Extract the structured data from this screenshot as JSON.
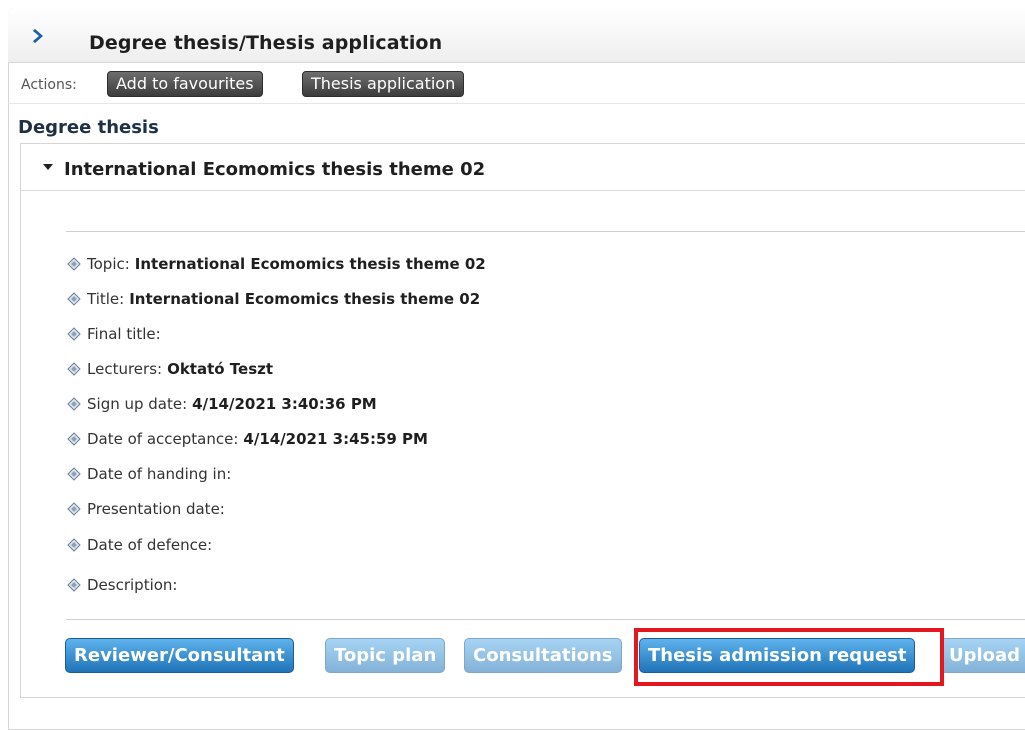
{
  "header": {
    "title": "Degree thesis/Thesis application",
    "chevron_icon": "chevron-right-icon"
  },
  "actions": {
    "label": "Actions:",
    "add_to_favourites": "Add to favourites",
    "thesis_application": "Thesis application"
  },
  "section_title": "Degree thesis",
  "panel": {
    "title": "International Ecomomics thesis theme 02",
    "toggle_icon": "caret-down-icon"
  },
  "fields": [
    {
      "label": "Topic:",
      "value": "International Ecomomics thesis theme 02"
    },
    {
      "label": "Title:",
      "value": "International Ecomomics thesis theme 02"
    },
    {
      "label": "Final title:",
      "value": ""
    },
    {
      "label": "Lecturers:",
      "value": "Oktató Teszt"
    },
    {
      "label": "Sign up date:",
      "value": "4/14/2021 3:40:36 PM"
    },
    {
      "label": "Date of acceptance:",
      "value": "4/14/2021 3:45:59 PM"
    },
    {
      "label": "Date of handing in:",
      "value": ""
    },
    {
      "label": "Presentation date:",
      "value": ""
    },
    {
      "label": "Date of defence:",
      "value": ""
    },
    {
      "label": "Description:",
      "value": ""
    }
  ],
  "buttons": {
    "reviewer": "Reviewer/Consultant",
    "topic_plan": "Topic plan",
    "consultations": "Consultations",
    "admission": "Thesis admission request",
    "upload": "Upload"
  },
  "colors": {
    "highlight": "#e4161f",
    "button_blue": "#1f74b8",
    "action_dark": "#3c3c3c"
  }
}
